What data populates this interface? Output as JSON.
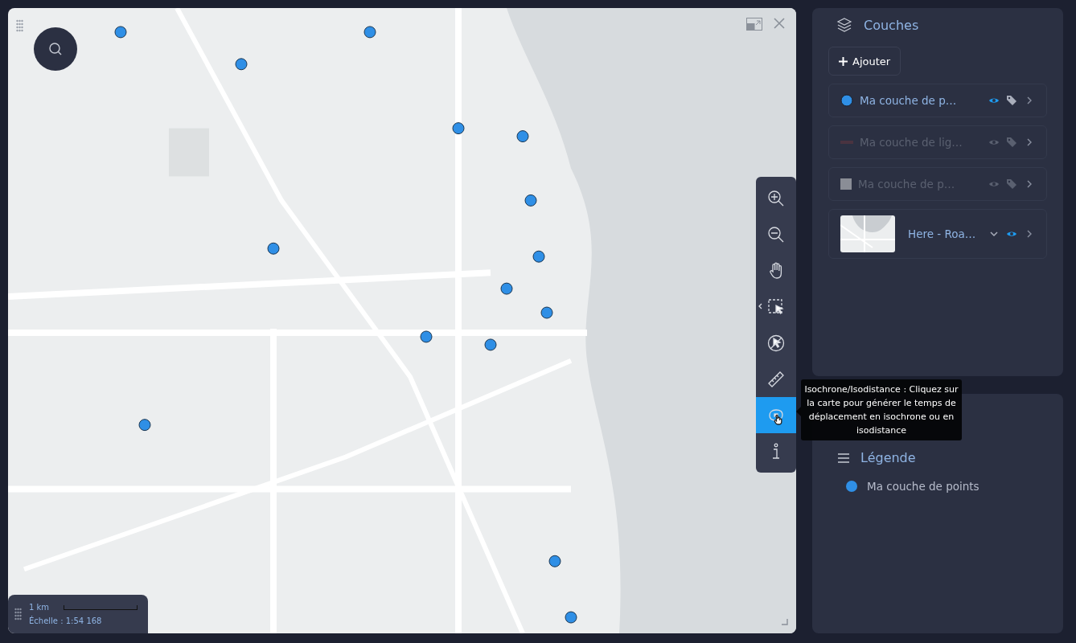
{
  "map": {
    "tools": [
      {
        "kind": "zoom-in",
        "selected": false
      },
      {
        "kind": "zoom-out",
        "selected": false
      },
      {
        "kind": "pan",
        "selected": false
      },
      {
        "kind": "select",
        "selected": false
      },
      {
        "kind": "deselect",
        "selected": false
      },
      {
        "kind": "measure",
        "selected": false
      },
      {
        "kind": "isochrone",
        "selected": true
      },
      {
        "kind": "info",
        "selected": false
      }
    ],
    "tooltip": "Isochrone/Isodistance : Cliquez sur la carte pour générer le temps de déplacement en isochrone ou en isodistance",
    "scale": {
      "distance": "1 km",
      "label": "Échelle : 1:54 168"
    }
  },
  "layers_panel": {
    "title": "Couches",
    "add_button": "Ajouter",
    "layers": [
      {
        "kind": "point",
        "name": "Ma couche de p…",
        "color": "#2f8fe6",
        "enabled": true
      },
      {
        "kind": "line",
        "name": "Ma couche de lig…",
        "color": "#4a3340",
        "enabled": false
      },
      {
        "kind": "polygon",
        "name": "Ma couche de p…",
        "color": "#8a8d96",
        "enabled": false
      },
      {
        "kind": "basemap",
        "name": "Here - Roa…",
        "enabled": true
      }
    ]
  },
  "legend": {
    "title": "Légende",
    "items": [
      {
        "name": "Ma couche de points",
        "color": "#2f8fe6"
      }
    ]
  }
}
